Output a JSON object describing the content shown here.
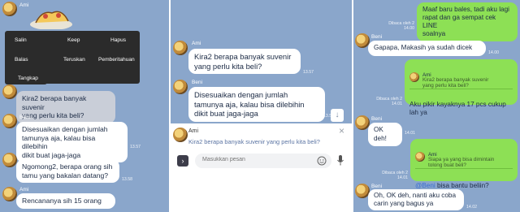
{
  "panel1": {
    "sender_ami_top": "Ami",
    "menu": {
      "salin": "Salin",
      "keep": "Keep",
      "hapus": "Hapus",
      "balas": "Balas",
      "teruskan": "Teruskan",
      "pemberitahuan": "Pemberitahuan",
      "tangkap": "Tangkap"
    },
    "msg_kira2": "Kira2 berapa banyak suvenir\nyang perlu kita beli?",
    "sender_beni_1": "Beni",
    "msg_disesuaikan": "Disesuaikan dengan jumlah\ntamunya aja, kalau bisa dilebihin\ndikit buat jaga-jaga",
    "time_1": "13.57",
    "msg_ngomong": "Ngomong2, berapa orang sih\ntamu yang bakalan datang?",
    "time_2": "13.58",
    "sender_ami_bottom": "Ami",
    "msg_rencananya": "Rencananya sih 15 orang"
  },
  "panel2": {
    "sender_ami": "Ami",
    "msg_kira2": "Kira2 berapa banyak suvenir\nyang perlu kita beli?",
    "time_1": "13.57",
    "sender_beni": "Beni",
    "msg_disesuaikan": "Disesuaikan dengan jumlah\ntamunya aja, kalau bisa dilebihin\ndikit buat jaga-jaga",
    "time_2": "13.57",
    "reply_sender": "Ami",
    "reply_text": "Kira2 berapa banyak suvenir yang perlu kita beli?",
    "input_placeholder": "Masukkan pesan"
  },
  "panel3": {
    "msg_maaf": "Maaf baru bales, tadi aku lagi\nrapat dan ga sempat cek LINE\nsoalnya",
    "meta_1": "Dibaca oleh 2\n14.00",
    "sender_beni_1": "Beni",
    "msg_gapapa": "Gapapa, Makasih ya sudah dicek",
    "time_1": "14.00",
    "quote_sender": "Ami",
    "quote_text": "Kira2 berapa banyak suvenir\nyang perlu kita beli?",
    "msg_aku_pikir": "Aku pikir kayaknya 17 pcs cukup\nlah ya",
    "meta_2": "Dibaca oleh 2\n14.01",
    "sender_beni_2": "Beni",
    "msg_ok": "OK deh!",
    "time_2": "14.01",
    "quote2_sender": "Ami",
    "quote2_text": "Siapa ya yang bisa dimintain\ntolong buat beli?",
    "mention": "@Beni",
    "msg_bisa": " bisa bantu beliin?",
    "meta_3": "Dibaca oleh 2\n14.01",
    "sender_beni_3": "Beni",
    "msg_oh_ok": "Oh, OK deh, nanti aku coba\ncarin yang bagus ya",
    "time_3": "14.02"
  },
  "colors": {
    "chat_bg": "#8aa6cb",
    "sent_bubble": "#8de055",
    "menu_bg": "#2b2b2b",
    "mention": "#3b6fd1"
  },
  "icons": [
    "avatar",
    "chevron-down-icon",
    "close-icon",
    "send-arrow-icon",
    "emoji-icon",
    "microphone-icon"
  ]
}
